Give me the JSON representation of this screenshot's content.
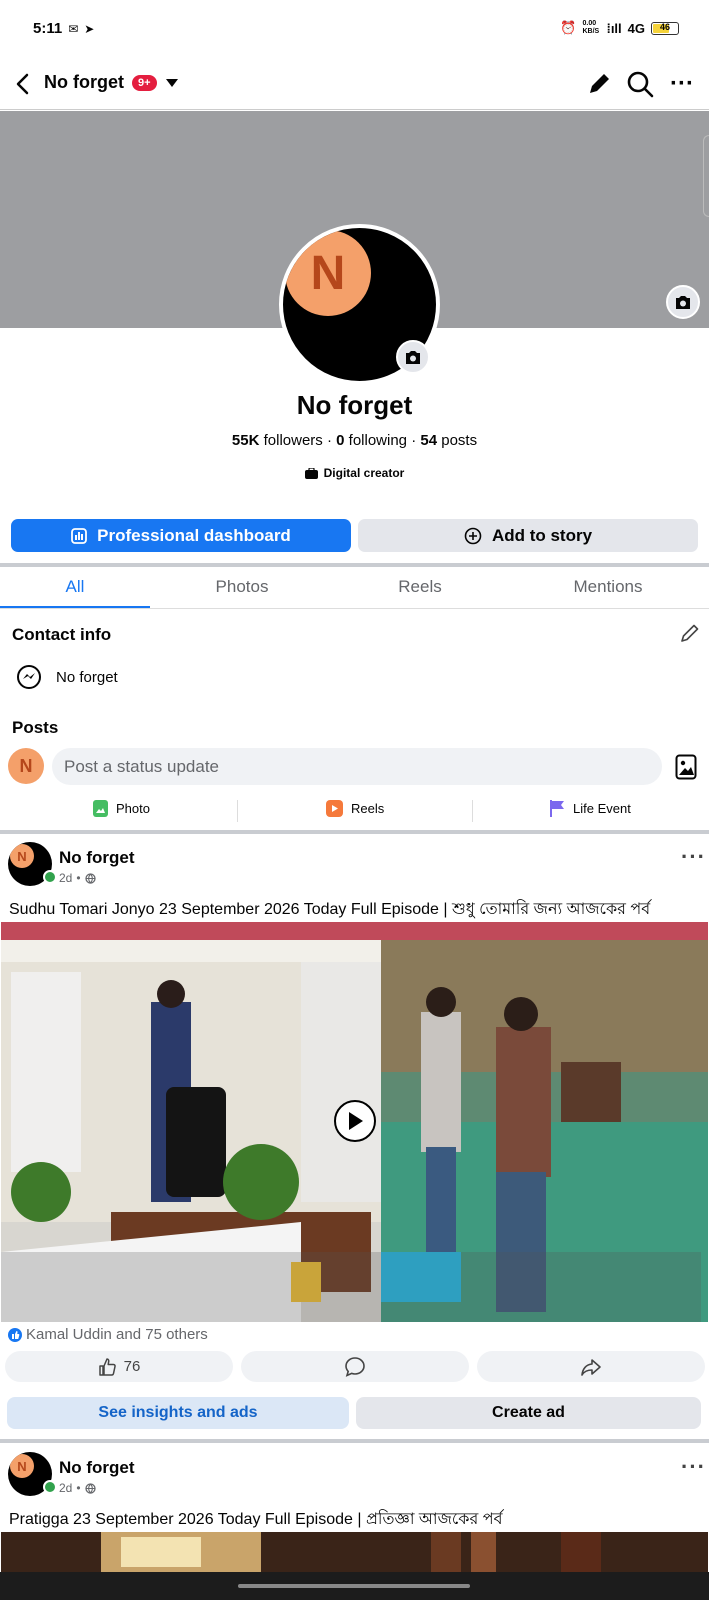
{
  "status_bar": {
    "time": "5:11",
    "speed": "0.00 KB/S",
    "network": "4G",
    "battery": "46"
  },
  "header": {
    "title": "No forget",
    "badge": "9+"
  },
  "profile": {
    "initial": "N",
    "name": "No forget",
    "followers_count": "55K",
    "followers_label": "followers",
    "following_count": "0",
    "following_label": "following",
    "posts_count": "54",
    "posts_label": "posts",
    "category": "Digital creator"
  },
  "actions": {
    "dashboard": "Professional dashboard",
    "add_story": "Add to story"
  },
  "tabs": [
    "All",
    "Photos",
    "Reels",
    "Mentions"
  ],
  "contact": {
    "title": "Contact info",
    "messenger": "No forget"
  },
  "posts_section": {
    "title": "Posts",
    "composer_placeholder": "Post a status update",
    "actions": [
      "Photo",
      "Reels",
      "Life Event"
    ]
  },
  "posts": [
    {
      "author": "No forget",
      "time": "2d",
      "text": "Sudhu Tomari Jonyo 23 September  2026 Today Full Episode | শুধু তোমারি জন্য আজকের পর্ব",
      "likes_line": "Kamal Uddin and 75 others",
      "like_count": "76",
      "insights_label": "See insights and ads",
      "create_ad_label": "Create ad"
    },
    {
      "author": "No forget",
      "time": "2d",
      "text": "Pratigga 23 September   2026 Today Full Episode | প্রতিজ্ঞা আজকের পর্ব"
    }
  ],
  "colors": {
    "accent": "#1877f2",
    "badge": "#e41e3f",
    "avatar_bg": "#f4a06a",
    "cover": "#9d9ea1"
  }
}
